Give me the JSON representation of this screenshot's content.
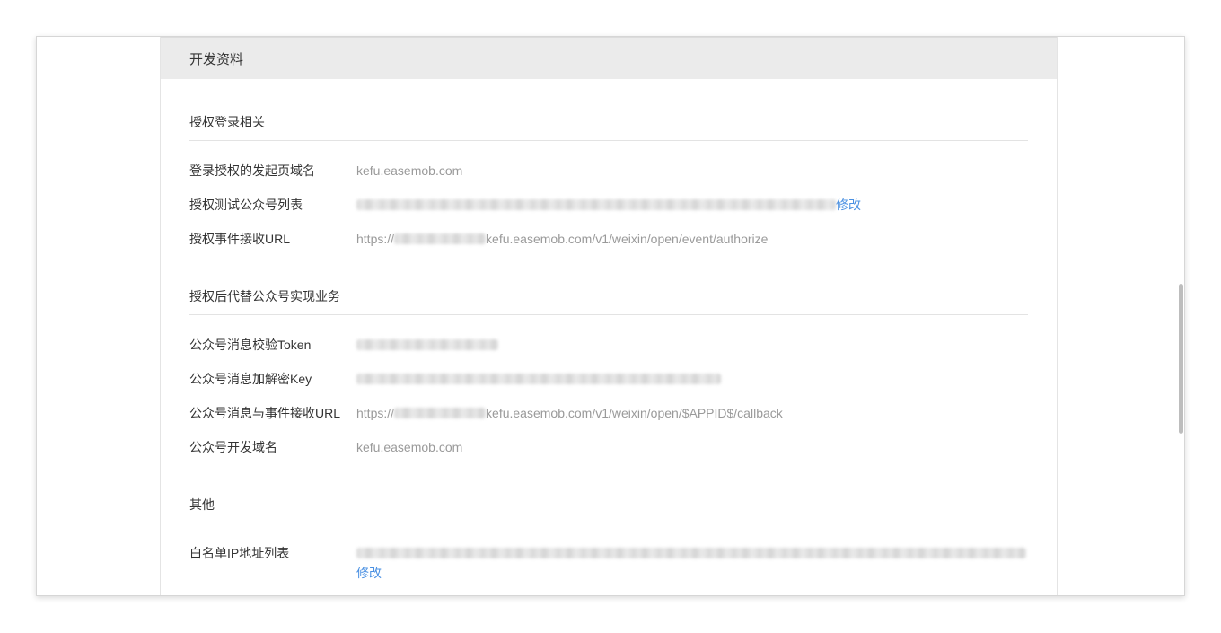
{
  "panel": {
    "title": "开发资料"
  },
  "sections": {
    "auth_login": {
      "title": "授权登录相关"
    },
    "auth_business": {
      "title": "授权后代替公众号实现业务"
    },
    "other": {
      "title": "其他"
    }
  },
  "rows": {
    "login_domain": {
      "label": "登录授权的发起页域名",
      "value": "kefu.easemob.com"
    },
    "test_accounts": {
      "label": "授权测试公众号列表",
      "action": "修改"
    },
    "event_url": {
      "label": "授权事件接收URL",
      "prefix": "https://",
      "suffix": "kefu.easemob.com/v1/weixin/open/event/authorize"
    },
    "token": {
      "label": "公众号消息校验Token"
    },
    "aes_key": {
      "label": "公众号消息加解密Key"
    },
    "msg_url": {
      "label": "公众号消息与事件接收URL",
      "prefix": "https://",
      "suffix": "kefu.easemob.com/v1/weixin/open/$APPID$/callback"
    },
    "dev_domain": {
      "label": "公众号开发域名",
      "value": "kefu.easemob.com"
    },
    "ip_whitelist": {
      "label": "白名单IP地址列表",
      "action": "修改"
    }
  },
  "colors": {
    "link": "#4a90e2",
    "header_bg": "#ebebeb",
    "muted_text": "#9a9a9a"
  }
}
